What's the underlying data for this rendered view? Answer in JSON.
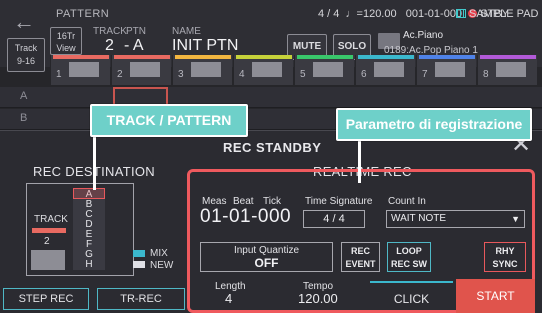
{
  "header": {
    "mode": "PATTERN",
    "time_sig": "4 / 4",
    "tempo": "♩=120.00",
    "position": "001-01-000",
    "status": "STBY",
    "sample_pad": "SAMPLE PAD",
    "view_button": "16Tr\nView",
    "track_label": "TRACK",
    "ptn_label": "PTN",
    "name_label": "NAME",
    "track_value": "2",
    "ptn_value": "- A",
    "name_value": "INIT PTN",
    "mute": "MUTE",
    "solo": "SOLO",
    "tone_name": "Ac.Piano",
    "tone_num": "0189:Ac.Pop Piano 1",
    "track_range_button": "Track\n9-16"
  },
  "tracks": [
    {
      "num": "1",
      "color": "#e86a61"
    },
    {
      "num": "2",
      "color": "#e86a61"
    },
    {
      "num": "3",
      "color": "#f2b640"
    },
    {
      "num": "4",
      "color": "#c6d23a"
    },
    {
      "num": "5",
      "color": "#39c76b"
    },
    {
      "num": "6",
      "color": "#3bb8cd"
    },
    {
      "num": "7",
      "color": "#4f82e8"
    },
    {
      "num": "8",
      "color": "#b25ad8"
    }
  ],
  "rows": [
    "A",
    "B"
  ],
  "dialog": {
    "title": "REC STANDBY",
    "rec_destination": "REC DESTINATION",
    "realtime_rec": "REALTIME REC",
    "dest_track_label": "TRACK",
    "dest_track_num": "2",
    "patterns": [
      "A",
      "B",
      "C",
      "D",
      "E",
      "F",
      "G",
      "H"
    ],
    "mix": "MIX",
    "new": "NEW",
    "step_rec": "STEP REC",
    "tr_rec": "TR-REC",
    "meas_lbl": "Meas",
    "beat_lbl": "Beat",
    "tick_lbl": "Tick",
    "meas_value": "01-01-000",
    "time_signature_lbl": "Time Signature",
    "time_signature": "4 / 4",
    "count_in_lbl": "Count In",
    "count_in": "WAIT NOTE",
    "input_quantize_lbl": "Input Quantize",
    "input_quantize": "OFF",
    "rec_event": "REC\nEVENT",
    "loop_rec_sw": "LOOP\nREC SW",
    "rhy_sync": "RHY\nSYNC",
    "length_lbl": "Length",
    "length": "4",
    "tempo_lbl": "Tempo",
    "tempo": "120.00",
    "click": "CLICK",
    "start": "START"
  },
  "callouts": {
    "track_pattern": "TRACK / PATTERN",
    "rec_param": "Parametro di registrazione"
  },
  "colors": {
    "accent_red": "#ef5a5e",
    "accent_teal": "#3bb8cd",
    "callout_bg": "#6ed0c9",
    "screen_bg": "#26262a"
  }
}
